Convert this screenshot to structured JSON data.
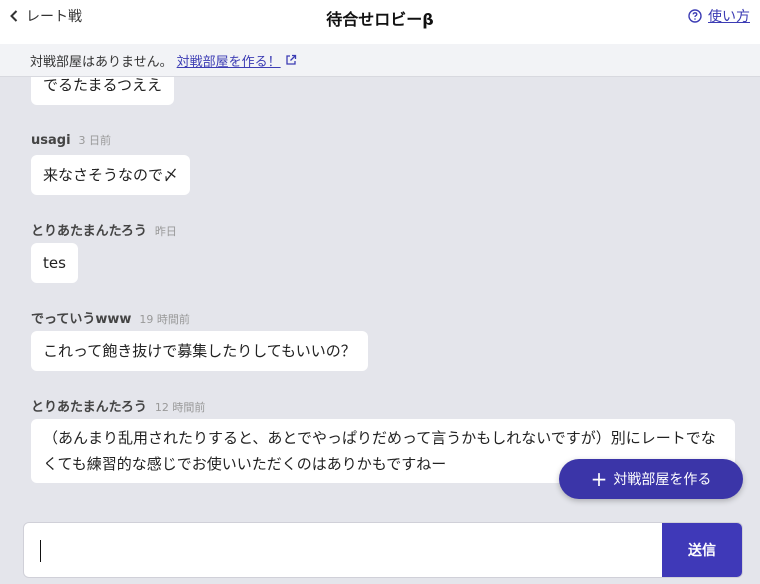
{
  "header": {
    "back_label": "レート戦",
    "title": "待合せロビーβ",
    "help_label": "使い方"
  },
  "notice": {
    "text": "対戦部屋はありません。",
    "link_label": "対戦部屋を作る！"
  },
  "messages": [
    {
      "text": "でるたまるつええ"
    },
    {
      "user": "usagi",
      "time": "3 日前",
      "text": "来なさそうなので〆"
    },
    {
      "user": "とりあたまんたろう",
      "time": "昨日",
      "text": "tes"
    },
    {
      "user": "でっていうwww",
      "time": "19 時間前",
      "text": "これって飽き抜けで募集したりしてもいいの？"
    },
    {
      "user": "とりあたまんたろう",
      "time": "12 時間前",
      "text": "（あんまり乱用されたりすると、あとでやっぱりだめって言うかもしれないですが）別にレートでなくても練習的な感じでお使いいただくのはありかもですねー"
    }
  ],
  "fab": {
    "label": "対戦部屋を作る"
  },
  "composer": {
    "value": "",
    "placeholder": "",
    "send_label": "送信"
  },
  "colors": {
    "accent": "#3b35a8",
    "link": "#3c3cb4",
    "background": "#e4e5eb"
  }
}
